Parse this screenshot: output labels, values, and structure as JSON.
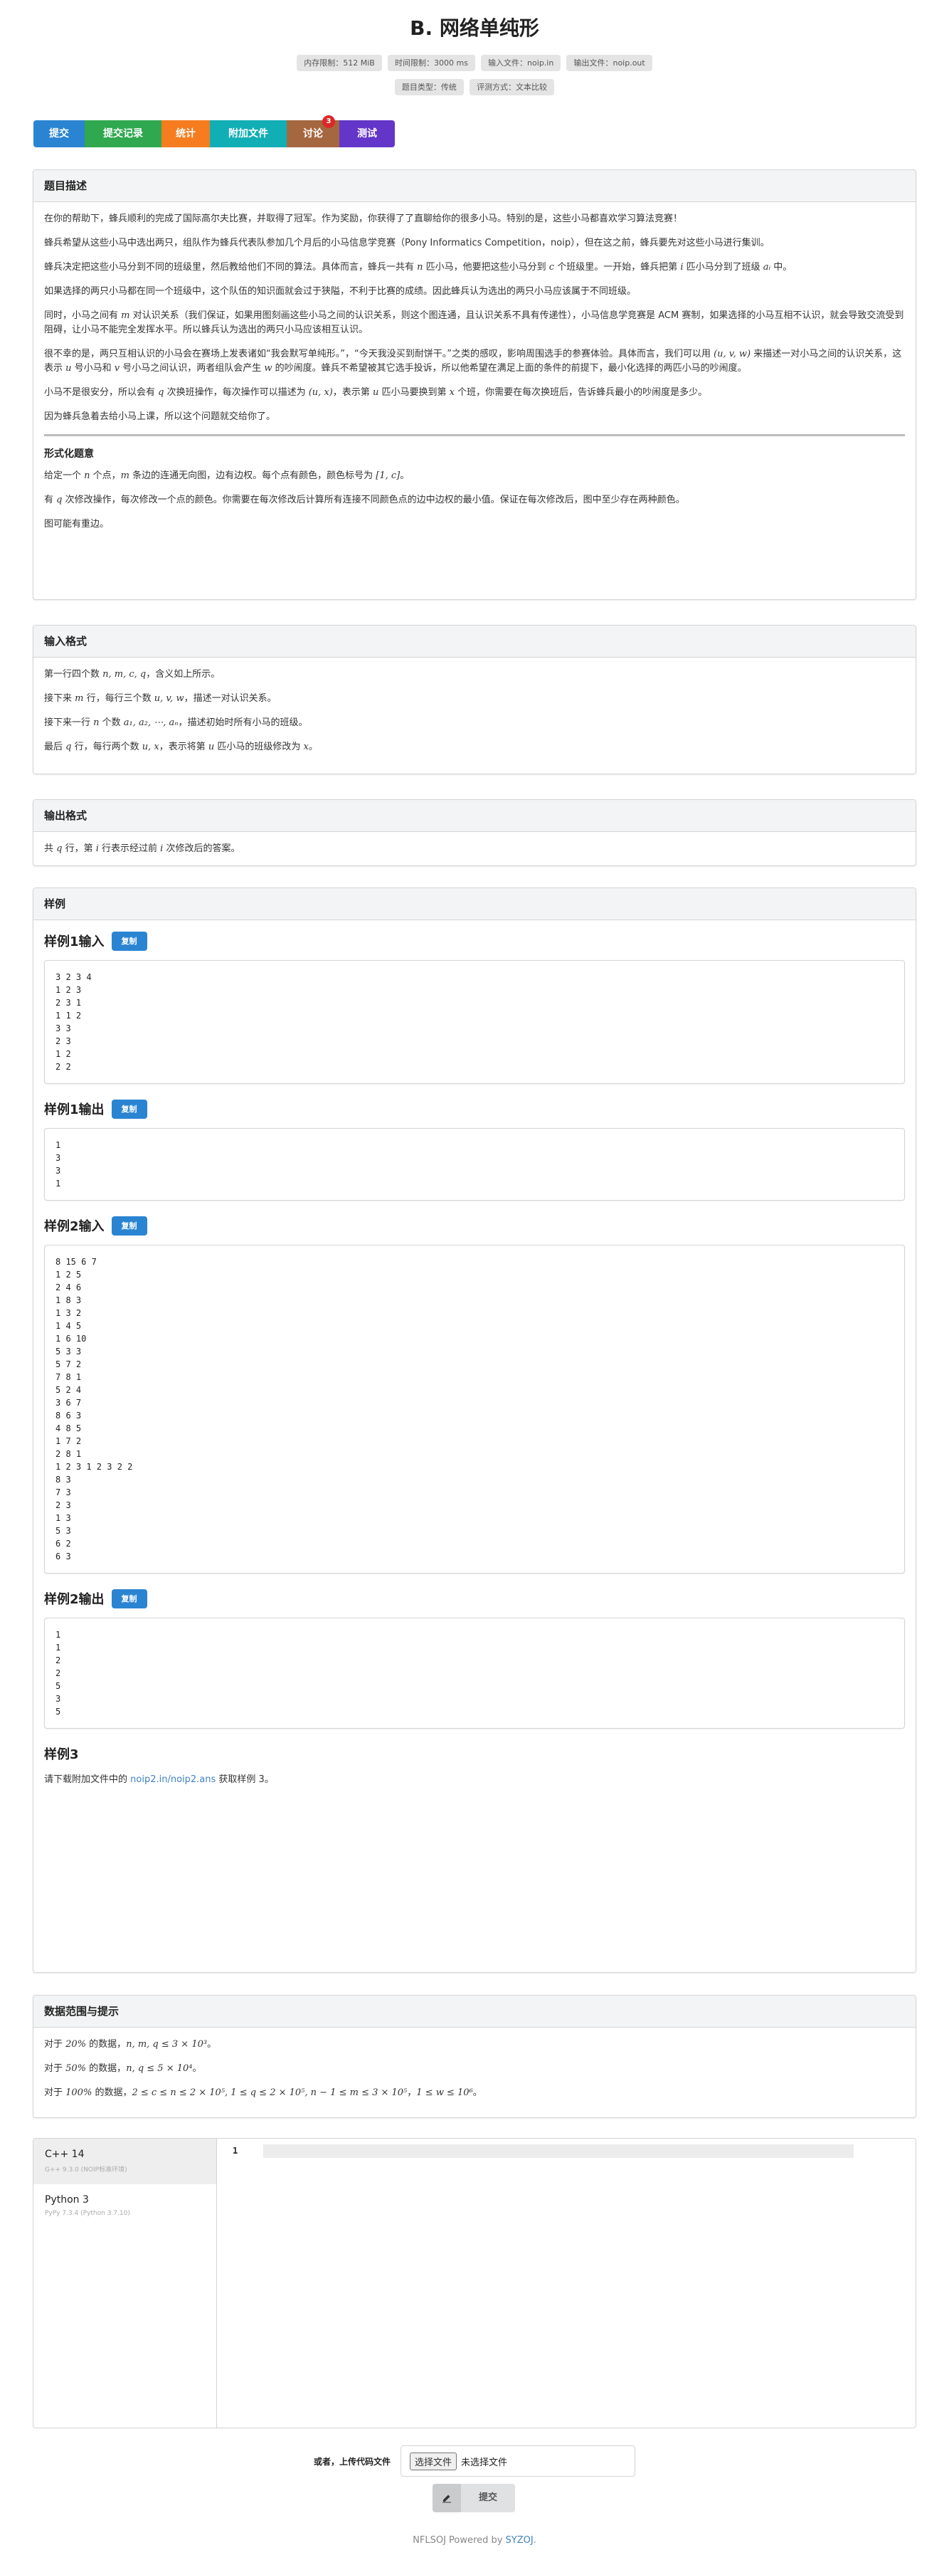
{
  "title": "B. 网络单纯形",
  "labels_row1": [
    "内存限制：512 MiB",
    "时间限制：3000 ms",
    "输入文件：noip.in",
    "输出文件：noip.out"
  ],
  "labels_row2": [
    "题目类型：传统",
    "评测方式：文本比较"
  ],
  "menu": {
    "submit": "提交",
    "records": "提交记录",
    "stats": "统计",
    "attachments": "附加文件",
    "discuss": "讨论",
    "discuss_badge": "3",
    "test": "测试"
  },
  "colors": {
    "submit": "#2a84d2",
    "records": "#2fa84f",
    "stats": "#f57c1f",
    "attachments": "#12aeb5",
    "discuss": "#a5673f",
    "test": "#6435c9",
    "badge": "#db2828"
  },
  "description": {
    "heading": "题目描述",
    "p1": "在你的帮助下，蜂兵顺利的完成了国际高尔夫比赛，并取得了冠军。作为奖励，你获得了了直聊给你的很多小马。特别的是，这些小马都喜欢学习算法竞赛！",
    "p2": "蜂兵希望从这些小马中选出两只，组队作为蜂兵代表队参加几个月后的小马信息学竞赛（Pony Informatics Competition，noip），但在这之前，蜂兵要先对这些小马进行集训。",
    "p3a": "蜂兵决定把这些小马分到不同的班级里，然后教给他们不同的算法。具体而言，蜂兵一共有 ",
    "p3_n": "n",
    "p3b": " 匹小马，他要把这些小马分到 ",
    "p3_c": "c",
    "p3c": " 个班级里。一开始，蜂兵把第 ",
    "p3_i": "i",
    "p3d": " 匹小马分到了班级 ",
    "p3_ai": "aᵢ",
    "p3e": " 中。",
    "p4": "如果选择的两只小马都在同一个班级中，这个队伍的知识面就会过于狭隘，不利于比赛的成绩。因此蜂兵认为选出的两只小马应该属于不同班级。",
    "p5a": "同时，小马之间有 ",
    "p5_m": "m",
    "p5b": " 对认识关系（我们保证，如果用图刻画这些小马之间的认识关系，则这个图连通，且认识关系不具有传递性），小马信息学竞赛是 ACM 赛制，如果选择的小马互相不认识，就会导致交流受到阻碍，让小马不能完全发挥水平。所以蜂兵认为选出的两只小马应该相互认识。",
    "p6a": "很不幸的是，两只互相认识的小马会在赛场上发表诸如“我会默写单纯形。”，“今天我没买到耐饼干。”之类的感叹，影响周围选手的参赛体验。具体而言，我们可以用 ",
    "p6_uvw": "(u, v, w)",
    "p6b": " 来描述一对小马之间的认识关系，这表示 ",
    "p6_u": "u",
    "p6c": " 号小马和 ",
    "p6_v": "v",
    "p6d": " 号小马之间认识，两者组队会产生 ",
    "p6_w": "w",
    "p6e": " 的吵闹度。蜂兵不希望被其它选手投诉，所以他希望在满足上面的条件的前提下，最小化选择的两匹小马的吵闹度。",
    "p7a": "小马不是很安分，所以会有 ",
    "p7_q": "q",
    "p7b": " 次换班操作，每次操作可以描述为 ",
    "p7_ux": "(u, x)",
    "p7c": "，表示第 ",
    "p7_u": "u",
    "p7d": " 匹小马要换到第 ",
    "p7_x": "x",
    "p7e": " 个班，你需要在每次换班后，告诉蜂兵最小的吵闹度是多少。",
    "p8": "因为蜂兵急着去给小马上课，所以这个问题就交给你了。",
    "formal_heading": "形式化题意",
    "f1a": "给定一个 ",
    "f1_n": "n",
    "f1b": " 个点，",
    "f1_m": "m",
    "f1c": " 条边的连通无向图，边有边权。每个点有颜色，颜色标号为 ",
    "f1_range": "[1, c]",
    "f1d": "。",
    "f2a": "有 ",
    "f2_q": "q",
    "f2b": " 次修改操作，每次修改一个点的颜色。你需要在每次修改后计算所有连接不同颜色点的边中边权的最小值。保证在每次修改后，图中至少存在两种颜色。",
    "f3": "图可能有重边。"
  },
  "input_format": {
    "heading": "输入格式",
    "l1a": "第一行四个数 ",
    "l1_vars": "n, m, c, q",
    "l1b": "，含义如上所示。",
    "l2a": "接下来 ",
    "l2_m": "m",
    "l2b": " 行，每行三个数 ",
    "l2_vars": "u, v, w",
    "l2c": "，描述一对认识关系。",
    "l3a": "接下来一行 ",
    "l3_n": "n",
    "l3b": " 个数 ",
    "l3_vars": "a₁, a₂, ⋯, aₙ",
    "l3c": "，描述初始时所有小马的班级。",
    "l4a": "最后 ",
    "l4_q": "q",
    "l4b": " 行，每行两个数 ",
    "l4_vars": "u, x",
    "l4c": "，表示将第 ",
    "l4_u": "u",
    "l4d": " 匹小马的班级修改为 ",
    "l4_x": "x",
    "l4e": "。"
  },
  "output_format": {
    "heading": "输出格式",
    "l1a": "共 ",
    "l1_q": "q",
    "l1b": " 行，第 ",
    "l1_i": "i",
    "l1c": " 行表示经过前 ",
    "l1_i2": "i",
    "l1d": " 次修改后的答案。"
  },
  "samples": {
    "heading": "样例",
    "copy_label": "复制",
    "s1_in_title": "样例1输入",
    "s1_in": "3 2 3 4\n1 2 3\n2 3 1\n1 1 2\n3 3\n2 3\n1 2\n2 2",
    "s1_out_title": "样例1输出",
    "s1_out": "1\n3\n3\n1",
    "s2_in_title": "样例2输入",
    "s2_in": "8 15 6 7\n1 2 5\n2 4 6\n1 8 3\n1 3 2\n1 4 5\n1 6 10\n5 3 3\n5 7 2\n7 8 1\n5 2 4\n3 6 7\n8 6 3\n4 8 5\n1 7 2\n2 8 1\n1 2 3 1 2 3 2 2\n8 3\n7 3\n2 3\n1 3\n5 3\n6 2\n6 3",
    "s2_out_title": "样例2输出",
    "s2_out": "1\n1\n2\n2\n5\n3\n5",
    "s3_title": "样例3",
    "s3_text_a": "请下载附加文件中的 ",
    "s3_link": "noip2.in/noip2.ans",
    "s3_text_b": " 获取样例 3。"
  },
  "constraints": {
    "heading": "数据范围与提示",
    "l1a": "对于 ",
    "l1_pct": "20%",
    "l1b": " 的数据，",
    "l1_expr": "n, m, q ≤ 3 × 10³",
    "l1c": "。",
    "l2a": "对于 ",
    "l2_pct": "50%",
    "l2b": " 的数据，",
    "l2_expr": "n, q ≤ 5 × 10⁴",
    "l2c": "。",
    "l3a": "对于 ",
    "l3_pct": "100%",
    "l3b": " 的数据，",
    "l3_expr": "2 ≤ c ≤ n ≤ 2 × 10⁵, 1 ≤ q ≤ 2 × 10⁵, n − 1 ≤ m ≤ 3 × 10⁵",
    "l3c": "，",
    "l3_expr2": "1 ≤ w ≤ 10⁶",
    "l3d": "。"
  },
  "editor": {
    "languages": [
      {
        "name": "C++ 14",
        "sub": "G++ 9.3.0 (NOIP标准环境)"
      },
      {
        "name": "Python 3",
        "sub": "PyPy 7.3.4 (Python 3.7.10)"
      }
    ],
    "line_number": "1"
  },
  "upload": {
    "label": "或者，上传代码文件",
    "file_button": "选择文件",
    "file_status": "未选择文件"
  },
  "submit_button": "提交",
  "footer": {
    "text": "NFLSOJ Powered by ",
    "link": "SYZOJ",
    "period": "."
  }
}
